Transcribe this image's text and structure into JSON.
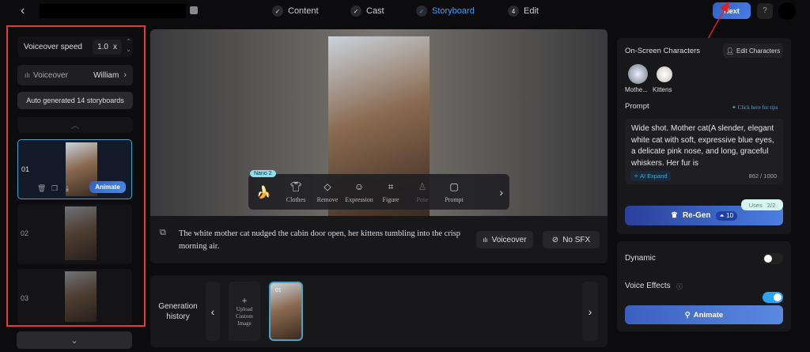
{
  "header": {
    "steps": [
      {
        "label": "Content",
        "mark": "✓"
      },
      {
        "label": "Cast",
        "mark": "✓"
      },
      {
        "label": "Storyboard",
        "mark": "✓",
        "active": true
      },
      {
        "label": "Edit",
        "mark": "4"
      }
    ],
    "next_label": "Next"
  },
  "left": {
    "speed_label": "Voiceover speed",
    "speed_value": "1.0",
    "speed_unit": "x",
    "voiceover_label": "Voiceover",
    "voiceover_value": "William",
    "auto_label": "Auto generated 14 storyboards",
    "storyboards": [
      {
        "num": "01",
        "animate": "Animate"
      },
      {
        "num": "02"
      },
      {
        "num": "03"
      }
    ]
  },
  "toolbar": {
    "badge": "Nano 2",
    "tools": [
      "Clothes",
      "Remove",
      "Expression",
      "Figure",
      "Pose",
      "Prompt"
    ]
  },
  "caption": {
    "text": "The white mother cat nudged the cabin door open, her kittens tumbling into the crisp morning air.",
    "voiceover": "Voiceover",
    "sfx": "No SFX"
  },
  "history": {
    "label": "Generation history",
    "upload": "Upload Custom Image",
    "items": [
      {
        "num": "01"
      }
    ]
  },
  "right": {
    "chars_title": "On-Screen Characters",
    "edit_chars": "Edit Characters",
    "characters": [
      "Mothe...",
      "Kittens"
    ],
    "prompt_label": "Prompt",
    "tips": "Click here for tips",
    "prompt": "Wide shot. Mother cat(A slender, elegant white cat with soft, expressive blue eyes, a delicate pink nose, and long, graceful whiskers. Her fur is",
    "ai_expand": "AI Expand",
    "count": "862 / 1000",
    "uses_label": "Uses",
    "uses": "2/2",
    "regen": "Re-Gen",
    "regen_cost": "10",
    "dynamic": "Dynamic",
    "dynamic_on": false,
    "voice_effects": "Voice Effects",
    "voice_effects_on": true,
    "animate": "Animate"
  },
  "colors": {
    "accent": "#3aa0ff",
    "highlight_border": "#e53935"
  }
}
